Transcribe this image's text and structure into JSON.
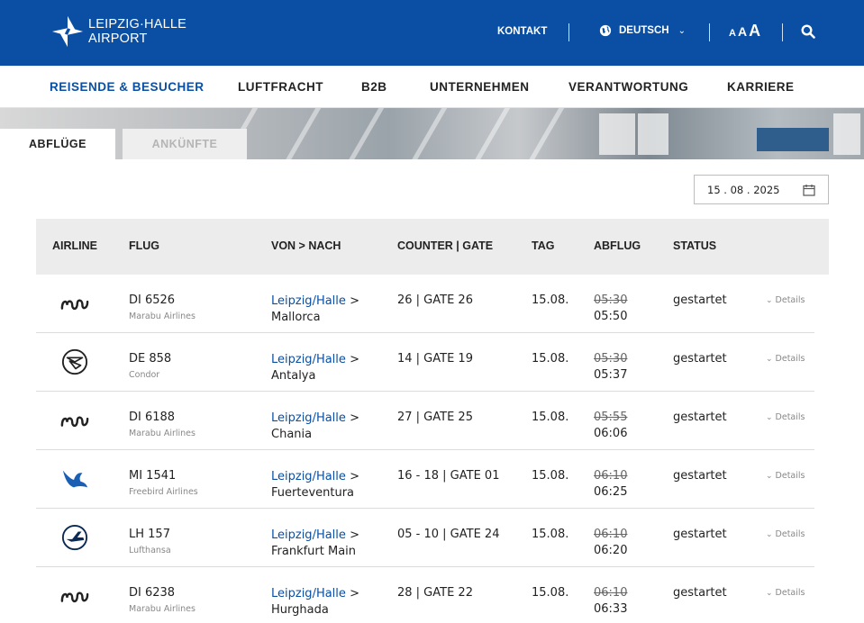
{
  "header": {
    "logo_line1": "LEIPZIG·HALLE",
    "logo_line2": "AIRPORT",
    "contact": "KONTAKT",
    "language": "DEUTSCH",
    "language_chevron": "⌄",
    "font_small": "A",
    "font_medium": "A",
    "font_large": "A",
    "search_icon": "search-icon"
  },
  "nav": {
    "items": [
      "REISENDE & BESUCHER",
      "LUFTFRACHT",
      "B2B",
      "UNTERNEHMEN",
      "VERANTWORTUNG",
      "KARRIERE"
    ],
    "active_index": 0
  },
  "tabs": {
    "departures": "ABFLÜGE",
    "arrivals": "ANKÜNFTE"
  },
  "date": {
    "value": "15 . 08 . 2025"
  },
  "table": {
    "headers": [
      "AIRLINE",
      "FLUG",
      "VON > NACH",
      "COUNTER | GATE",
      "TAG",
      "ABFLUG",
      "STATUS"
    ],
    "details_label": "Details",
    "rows": [
      {
        "logo": "marabu-logo-icon",
        "flight": "DI 6526",
        "airline": "Marabu Airlines",
        "from": "Leipzig/Halle",
        "arrow": ">",
        "to": "Mallorca",
        "counter": "26 |  GATE 26",
        "day": "15.08.",
        "scheduled": "05:30",
        "actual": "05:50",
        "status": "gestartet"
      },
      {
        "logo": "condor-logo-icon",
        "flight": "DE 858",
        "airline": "Condor",
        "from": "Leipzig/Halle",
        "arrow": ">",
        "to": "Antalya",
        "counter": "14 |  GATE 19",
        "day": "15.08.",
        "scheduled": "05:30",
        "actual": "05:37",
        "status": "gestartet"
      },
      {
        "logo": "marabu-logo-icon",
        "flight": "DI 6188",
        "airline": "Marabu Airlines",
        "from": "Leipzig/Halle",
        "arrow": ">",
        "to": "Chania",
        "counter": "27 |  GATE 25",
        "day": "15.08.",
        "scheduled": "05:55",
        "actual": "06:06",
        "status": "gestartet"
      },
      {
        "logo": "freebird-logo-icon",
        "flight": "MI 1541",
        "airline": "Freebird Airlines",
        "from": "Leipzig/Halle",
        "arrow": ">",
        "to": "Fuerteventura",
        "counter": "16 - 18 |  GATE 01",
        "day": "15.08.",
        "scheduled": "06:10",
        "actual": "06:25",
        "status": "gestartet"
      },
      {
        "logo": "lufthansa-logo-icon",
        "flight": "LH 157",
        "airline": "Lufthansa",
        "from": "Leipzig/Halle",
        "arrow": ">",
        "to": "Frankfurt Main",
        "counter": "05 - 10 |  GATE 24",
        "day": "15.08.",
        "scheduled": "06:10",
        "actual": "06:20",
        "status": "gestartet"
      },
      {
        "logo": "marabu-logo-icon",
        "flight": "DI 6238",
        "airline": "Marabu Airlines",
        "from": "Leipzig/Halle",
        "arrow": ">",
        "to": "Hurghada",
        "counter": "28 |  GATE 22",
        "day": "15.08.",
        "scheduled": "06:10",
        "actual": "06:33",
        "status": "gestartet"
      }
    ]
  },
  "colors": {
    "brand_blue": "#0a4fa3",
    "header_gray": "#ececec"
  }
}
